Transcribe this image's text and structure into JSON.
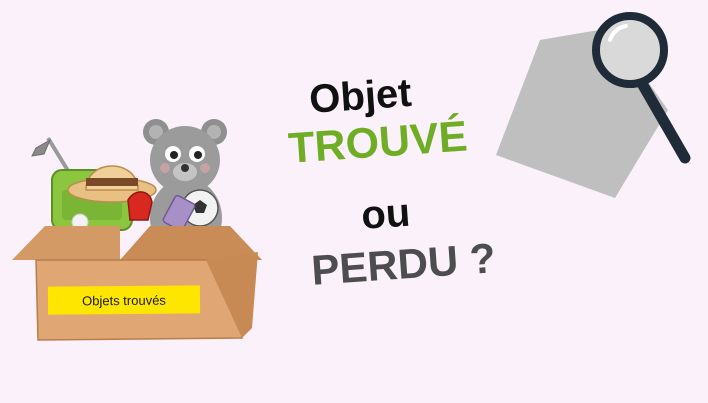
{
  "headline": {
    "line1": "Objet",
    "line2": "TROUVÉ",
    "line3": "ou",
    "line4": "PERDU ?"
  },
  "box_label": "Objets trouvés",
  "colors": {
    "background": "#fbf1fb",
    "accent_green": "#6fae24",
    "dark_text": "#111111",
    "grey_text": "#4d4d4f",
    "box": "#e0a774",
    "label": "#ffe600"
  },
  "icons": [
    "lost-and-found-box-illustration",
    "magnifying-glass-icon"
  ]
}
